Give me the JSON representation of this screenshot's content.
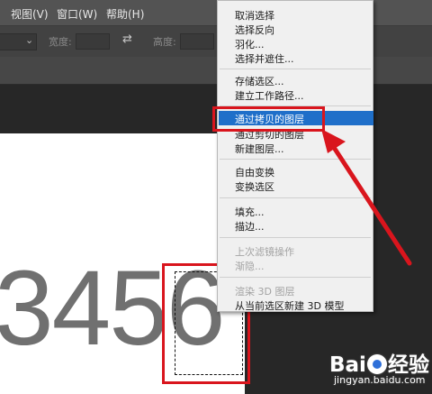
{
  "menubar": {
    "items": [
      {
        "label": "视图(V)"
      },
      {
        "label": "窗口(W)"
      },
      {
        "label": "帮助(H)"
      }
    ]
  },
  "options_bar": {
    "width_label": "宽度:",
    "height_label": "高度:",
    "swap_icon": "swap-arrows-icon"
  },
  "canvas": {
    "number_text": "3456"
  },
  "context_menu": {
    "items": [
      {
        "label": "取消选择",
        "enabled": true
      },
      {
        "label": "选择反向",
        "enabled": true
      },
      {
        "label": "羽化...",
        "enabled": true
      },
      {
        "label": "选择并遮住...",
        "enabled": true
      },
      {
        "label": "存储选区...",
        "enabled": true
      },
      {
        "label": "建立工作路径...",
        "enabled": true
      },
      {
        "label": "通过拷贝的图层",
        "enabled": true,
        "highlighted": true
      },
      {
        "label": "通过剪切的图层",
        "enabled": true
      },
      {
        "label": "新建图层...",
        "enabled": true
      },
      {
        "label": "自由变换",
        "enabled": true
      },
      {
        "label": "变换选区",
        "enabled": true
      },
      {
        "label": "填充...",
        "enabled": true
      },
      {
        "label": "描边...",
        "enabled": true
      },
      {
        "label": "上次滤镜操作",
        "enabled": false
      },
      {
        "label": "渐隐...",
        "enabled": false
      },
      {
        "label": "渲染 3D 图层",
        "enabled": false
      },
      {
        "label": "从当前选区新建 3D 模型",
        "enabled": true
      }
    ]
  },
  "annotation": {
    "color": "#d9151d"
  },
  "watermark": {
    "brand_pre": "Bai",
    "brand_post": "经验",
    "url": "jingyan.baidu.com"
  }
}
